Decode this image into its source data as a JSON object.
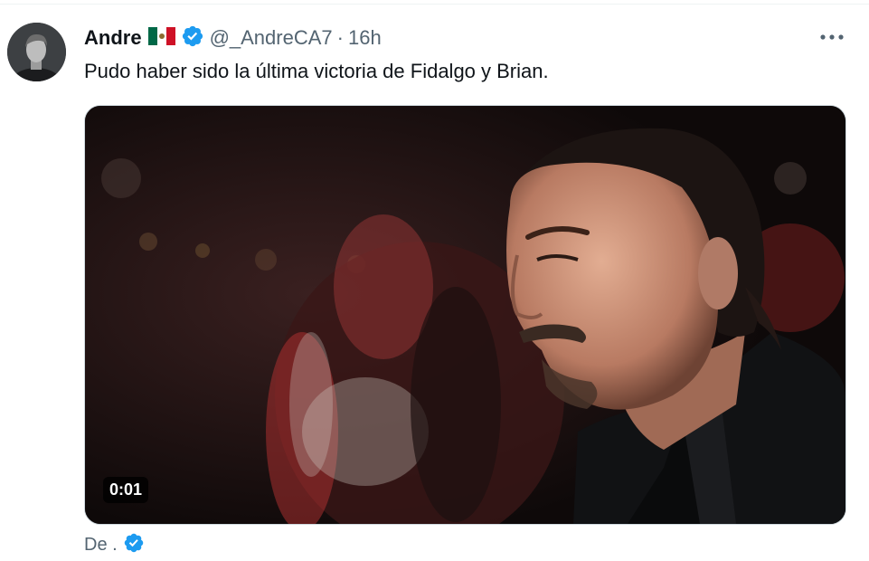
{
  "tweet": {
    "author_name": "Andre",
    "flag": "mexico-flag",
    "verified": true,
    "handle": "@_AndreCA7",
    "separator": "·",
    "time": "16h",
    "text": "Pudo haber sido la última victoria de Fidalgo y Brian.",
    "media": {
      "type": "video",
      "duration": "0:01"
    },
    "footer_text": "De ."
  },
  "colors": {
    "verified_blue": "#1d9bf0",
    "secondary_text": "#536471",
    "primary_text": "#0f1419"
  },
  "icons": {
    "more": "more-horizontal-icon",
    "verified": "verified-badge-icon"
  }
}
